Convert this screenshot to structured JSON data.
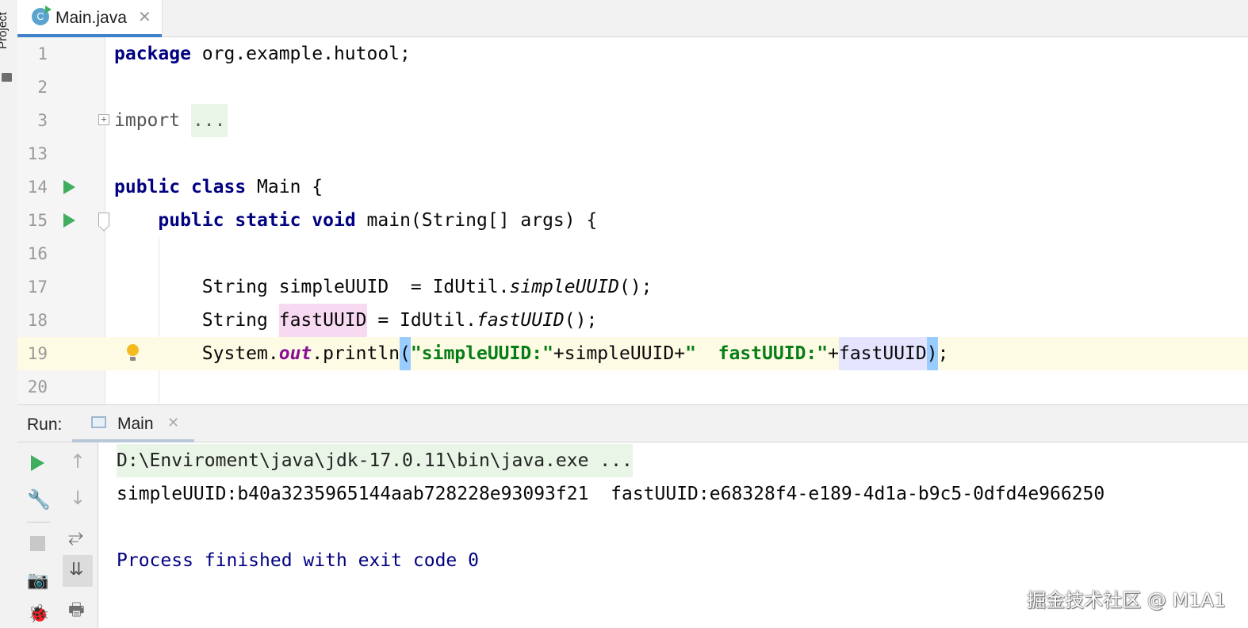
{
  "sidebar": {
    "project_label": "Project"
  },
  "editor_tab": {
    "filename": "Main.java",
    "close": "✕",
    "icon_letter": "C"
  },
  "editor": {
    "lines": [
      {
        "num": "1",
        "code": [
          {
            "t": "package",
            "c": "kw"
          },
          {
            "t": " org.example.hutool;"
          }
        ]
      },
      {
        "num": "2",
        "code": []
      },
      {
        "num": "3",
        "code": [
          {
            "t": "import",
            "c": "kw-gray"
          },
          {
            "t": " "
          },
          {
            "t": "...",
            "c": "import-fold"
          }
        ]
      },
      {
        "num": "13",
        "code": []
      },
      {
        "num": "14",
        "code": [
          {
            "t": "public",
            "c": "kw"
          },
          {
            "t": " "
          },
          {
            "t": "class",
            "c": "kw"
          },
          {
            "t": " Main {"
          }
        ]
      },
      {
        "num": "15",
        "code": [
          {
            "t": "    "
          },
          {
            "t": "public",
            "c": "kw"
          },
          {
            "t": " "
          },
          {
            "t": "static",
            "c": "kw"
          },
          {
            "t": " "
          },
          {
            "t": "void",
            "c": "kw"
          },
          {
            "t": " main(String[] args) {"
          }
        ]
      },
      {
        "num": "16",
        "code": []
      },
      {
        "num": "17",
        "code": [
          {
            "t": "        String simpleUUID  = IdUtil."
          },
          {
            "t": "simpleUUID",
            "c": "ital"
          },
          {
            "t": "();"
          }
        ]
      },
      {
        "num": "18",
        "code": [
          {
            "t": "        String "
          },
          {
            "t": "fastUUID",
            "c": "hl-pink"
          },
          {
            "t": " = IdUtil."
          },
          {
            "t": "fastUUID",
            "c": "ital"
          },
          {
            "t": "();"
          }
        ]
      },
      {
        "num": "19",
        "code": [
          {
            "t": "        System."
          },
          {
            "t": "out",
            "c": "static-field"
          },
          {
            "t": ".println"
          },
          {
            "t": "(",
            "c": "hl-brace"
          },
          {
            "t": "\"simpleUUID:\"",
            "c": "str"
          },
          {
            "t": "+simpleUUID+"
          },
          {
            "t": "\"  fastUUID:\"",
            "c": "str"
          },
          {
            "t": "+"
          },
          {
            "t": "fastUUID",
            "c": "hl-lav"
          },
          {
            "t": "CARET"
          },
          {
            "t": ")",
            "c": "hl-brace"
          },
          {
            "t": ";"
          }
        ]
      },
      {
        "num": "20",
        "code": []
      }
    ]
  },
  "run_panel": {
    "label": "Run:",
    "tab_label": "Main",
    "tab_close": "✕",
    "console": {
      "command": "D:\\Enviroment\\java\\jdk-17.0.11\\bin\\java.exe ...",
      "output": "simpleUUID:b40a3235965144aab728228e93093f21  fastUUID:e68328f4-e189-4d1a-b9c5-0dfd4e966250",
      "exit": "Process finished with exit code 0"
    }
  },
  "toolbar_icons": {
    "wrench": "🔧",
    "camera": "📷",
    "bug": "🐞",
    "up": "↑",
    "down": "↓",
    "wrap": "⥂",
    "scroll": "⇊",
    "print": "🖶"
  },
  "watermark": "掘金技术社区 @ M1A1"
}
